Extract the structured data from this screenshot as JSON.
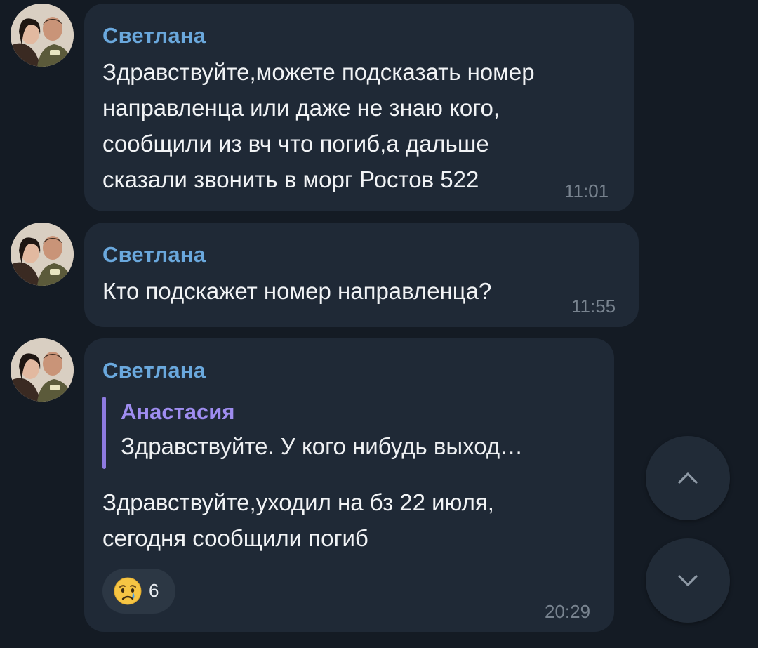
{
  "messages": [
    {
      "sender": "Светлана",
      "text": "Здравствуйте,можете подсказать номер\nнаправленца или даже не знаю кого,\nсообщили из вч что погиб,а дальше\nсказали звонить в морг Ростов 522",
      "time": "11:01"
    },
    {
      "sender": "Светлана",
      "text": "Кто подскажет номер направленца?",
      "time": "11:55"
    },
    {
      "sender": "Светлана",
      "reply": {
        "author": "Анастасия",
        "text": "Здравствуйте. У кого нибудь выход…"
      },
      "text": "Здравствуйте,уходил на бз 22 июля,\nсегодня сообщили погиб",
      "reaction": {
        "emoji": "crying-face",
        "count": "6"
      },
      "time": "20:29"
    }
  ],
  "controls": {
    "scroll_up_icon": "chevron-up-icon",
    "scroll_down_icon": "chevron-down-icon"
  },
  "colors": {
    "background": "#141b24",
    "bubble": "#1f2936",
    "sender_name": "#6aa8dd",
    "reply_accent": "#8d7ae0",
    "timestamp": "#78838f"
  }
}
